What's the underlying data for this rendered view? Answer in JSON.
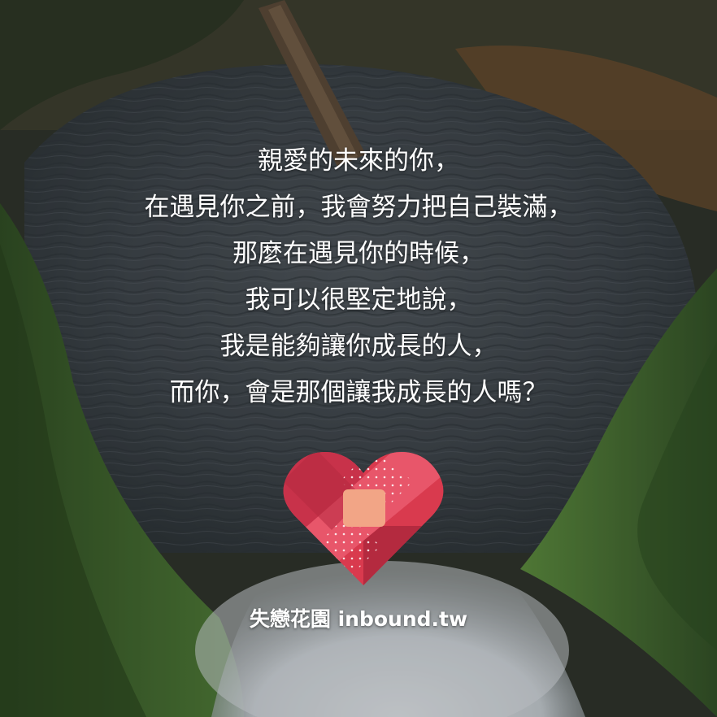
{
  "poem": {
    "lines": [
      "親愛的未來的你，",
      "在遇見你之前，我會努力把自己裝滿，",
      "那麼在遇見你的時候，",
      "我可以很堅定地說，",
      "我是能夠讓你成長的人，",
      "而你，會是那個讓我成長的人嗎？"
    ]
  },
  "brand": {
    "text": "失戀花園 inbound.tw"
  },
  "colors": {
    "text": "#ffffff",
    "heart_red": "#d93a4e",
    "heart_dark": "#b42a3f",
    "heart_light": "#e8566a",
    "bandage": "#f2a586",
    "water": "#3e454b",
    "moss": "#3f6b2c"
  },
  "icons": {
    "logo": "bandaged-heart-icon"
  }
}
